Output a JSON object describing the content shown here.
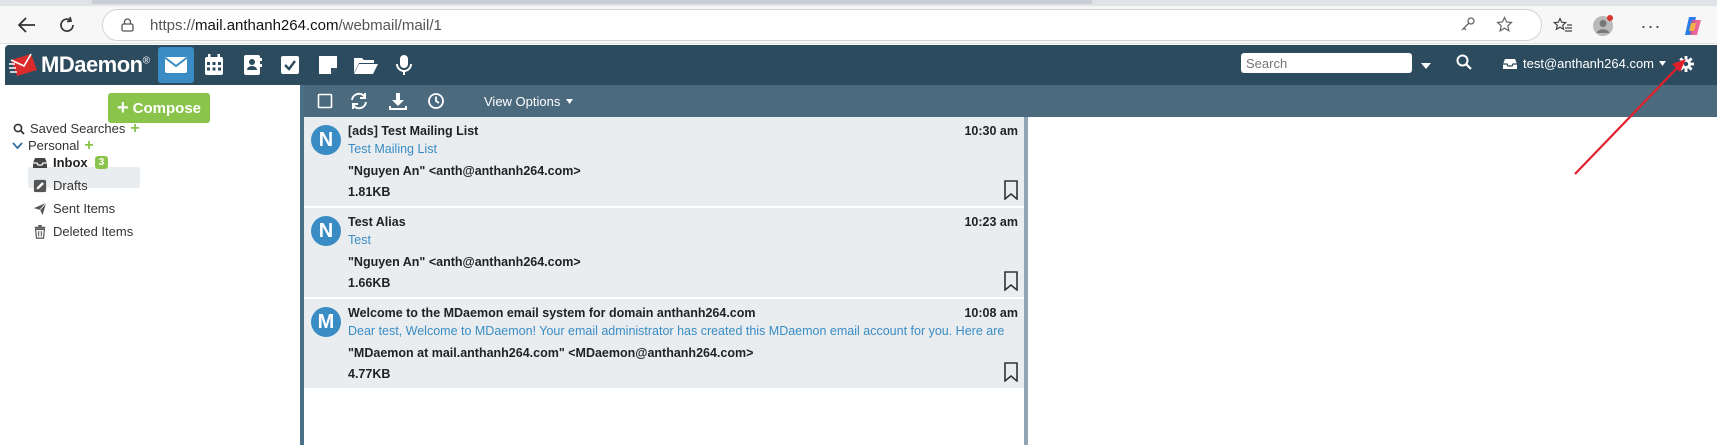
{
  "browser": {
    "url_scheme": "https://",
    "url_host": "mail.anthanh264.com",
    "url_path": "/webmail/mail/1"
  },
  "app": {
    "logo_text": "MDaemon",
    "logo_reg": "®",
    "search_placeholder": "Search",
    "account": "test@anthanh264.com"
  },
  "sidebar": {
    "compose_label": "Compose",
    "saved_searches": "Saved Searches",
    "personal": "Personal",
    "folders": [
      {
        "label": "Inbox",
        "badge": "3",
        "icon": "inbox-icon"
      },
      {
        "label": "Drafts",
        "icon": "pencil-icon"
      },
      {
        "label": "Sent Items",
        "icon": "paper-plane-icon"
      },
      {
        "label": "Deleted Items",
        "icon": "trash-icon"
      }
    ]
  },
  "toolbar": {
    "view_options": "View Options"
  },
  "messages": [
    {
      "initial": "N",
      "subject": "[ads] Test Mailing List",
      "time": "10:30 am",
      "preview": "Test Mailing List",
      "from": "\"Nguyen An\" <anth@anthanh264.com>",
      "size": "1.81KB"
    },
    {
      "initial": "N",
      "subject": "Test Alias",
      "time": "10:23 am",
      "preview": "Test",
      "from": "\"Nguyen An\" <anth@anthanh264.com>",
      "size": "1.66KB"
    },
    {
      "initial": "M",
      "subject": "Welcome to the MDaemon email system for domain anthanh264.com",
      "time": "10:08 am",
      "preview": "Dear test, Welcome to MDaemon! Your email administrator has created this MDaemon email account for you. Here are",
      "from": "\"MDaemon at mail.anthanh264.com\" <MDaemon@anthanh264.com>",
      "size": "4.77KB"
    }
  ],
  "colors": {
    "header": "#2d4b5e",
    "toolbar": "#4b6a7e",
    "accent": "#3a8cc4",
    "green": "#8ac44a",
    "annotation": "#e0202a"
  }
}
